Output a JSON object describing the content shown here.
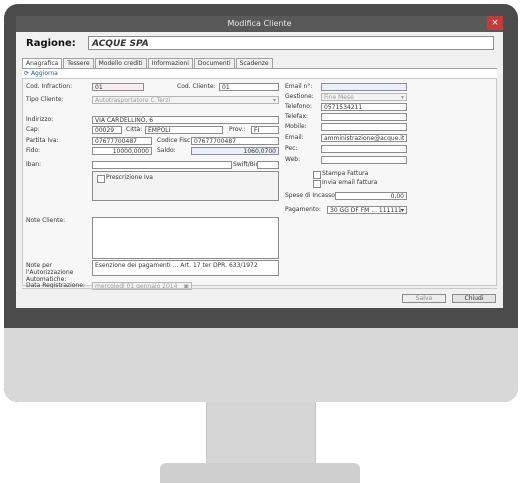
{
  "window": {
    "title": "Modifica Cliente",
    "close_glyph": "×"
  },
  "ragione": {
    "label": "Ragione:",
    "value": "ACQUE SPA"
  },
  "tabs": [
    "Anagrafica",
    "Tessere",
    "Modello crediti",
    "Informazioni",
    "Documenti",
    "Scadenze"
  ],
  "toolbar": {
    "refresh_label": "Aggiorna",
    "refresh_icon": "refresh-icon"
  },
  "left": {
    "cod_infraction": {
      "label": "Cod. Infraction:",
      "value": "01"
    },
    "cod_cliente": {
      "label": "Cod. Cliente:",
      "value": "01"
    },
    "tipo_cliente": {
      "label": "Tipo Cliente:",
      "value": "Autotrasportatore C.Terzi"
    },
    "indirizzo": {
      "label": "Indirizzo:",
      "value": "VIA CARDELLINO, 6"
    },
    "cap": {
      "label": "Cap:",
      "value": "00029"
    },
    "citta": {
      "label": "Città:",
      "value": "EMPOLI"
    },
    "prov": {
      "label": "Prov.:",
      "value": "FI"
    },
    "partita_iva": {
      "label": "Partita Iva:",
      "value": "07677700487"
    },
    "codice_fisc": {
      "label": "Codice Fisc.:",
      "value": "07677700487"
    },
    "fido": {
      "label": "Fido:",
      "value": "10000,0000"
    },
    "saldo": {
      "label": "Saldo:",
      "value": "1060,0700"
    },
    "iban": {
      "label": "Iban:",
      "value": ""
    },
    "swift": {
      "label": "Swift/Bic:",
      "value": ""
    },
    "check_label": "Prescrizione Iva",
    "note": {
      "label": "Note Cliente:"
    },
    "note_aut": {
      "label": "Note per l'Autorizzazione Automatiche:",
      "value": "Esenzione dei pagamenti ... Art. 17 ter DPR. 633/1972"
    },
    "data_reg": {
      "label": "Data Registrazione:",
      "value": "mercoledì 01 gennaio 2014"
    }
  },
  "right": {
    "email": {
      "label": "Email n°:",
      "value": ""
    },
    "gestione": {
      "label": "Gestione:",
      "value": "Fine Mese"
    },
    "telefono": {
      "label": "Telefono:",
      "value": "0571534211"
    },
    "telefax": {
      "label": "Telefax:",
      "value": ""
    },
    "mobile": {
      "label": "Mobile:",
      "value": ""
    },
    "email2": {
      "label": "Email:",
      "value": "amministrazione@acque.it"
    },
    "pec": {
      "label": "Pec:",
      "value": ""
    },
    "web": {
      "label": "Web:",
      "value": ""
    },
    "check1": "Stampa Fattura",
    "check2": "Invia email fattura",
    "spese": {
      "label": "Spese di Incasso:",
      "value": "0,00"
    },
    "pagamento": {
      "label": "Pagamento:",
      "value": "30 GG DF FM ... 111111"
    }
  },
  "buttons": {
    "save": "Salva",
    "close": "Chiudi"
  }
}
